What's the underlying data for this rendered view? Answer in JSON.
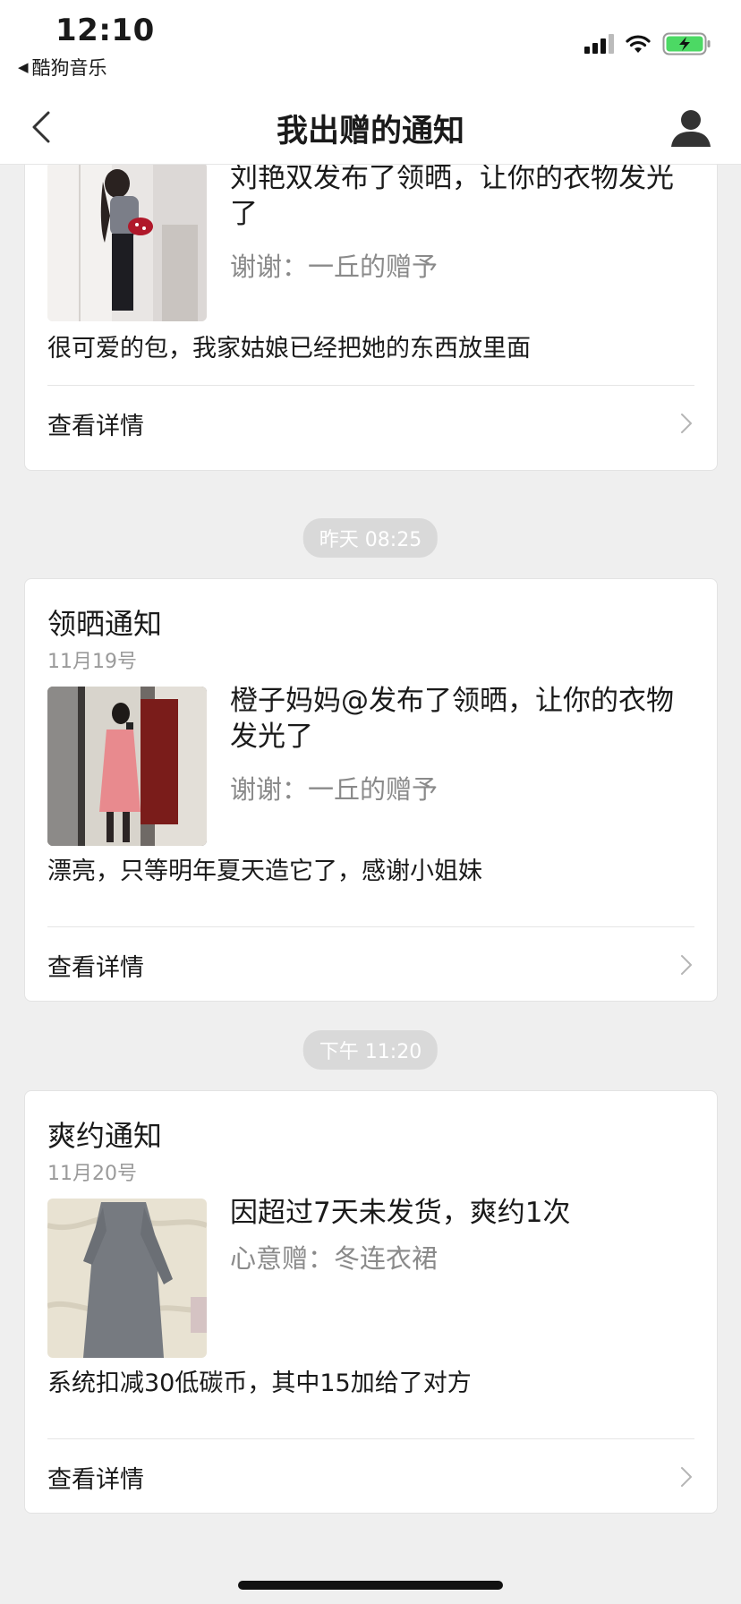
{
  "status_bar": {
    "time": "12:10",
    "back_app": "酷狗音乐",
    "icons": [
      "signal-icon",
      "wifi-icon",
      "battery-charging-icon"
    ],
    "battery_color": "#4cd964"
  },
  "nav": {
    "title": "我出赠的通知",
    "back_icon": "chevron-left-icon",
    "user_icon": "user-icon"
  },
  "notifications": [
    {
      "title": "",
      "date": "",
      "headline": "刘艳双发布了领晒，让你的衣物发光了",
      "subline": "谢谢：一丘的赠予",
      "comment": "很可爱的包，我家姑娘已经把她的东西放里面",
      "detail_label": "查看详情"
    },
    {
      "time_label": "昨天 08:25",
      "title": "领晒通知",
      "date": "11月19号",
      "headline": "橙子妈妈@发布了领晒，让你的衣物发光了",
      "subline": "谢谢：一丘的赠予",
      "comment": "漂亮，只等明年夏天造它了，感谢小姐妹",
      "detail_label": "查看详情"
    },
    {
      "time_label": "下午 11:20",
      "title": "爽约通知",
      "date": "11月20号",
      "headline": "因超过7天未发货，爽约1次",
      "subline": "心意赠：冬连衣裙",
      "comment": "系统扣减30低碳币，其中15加给了对方",
      "detail_label": "查看详情"
    }
  ]
}
